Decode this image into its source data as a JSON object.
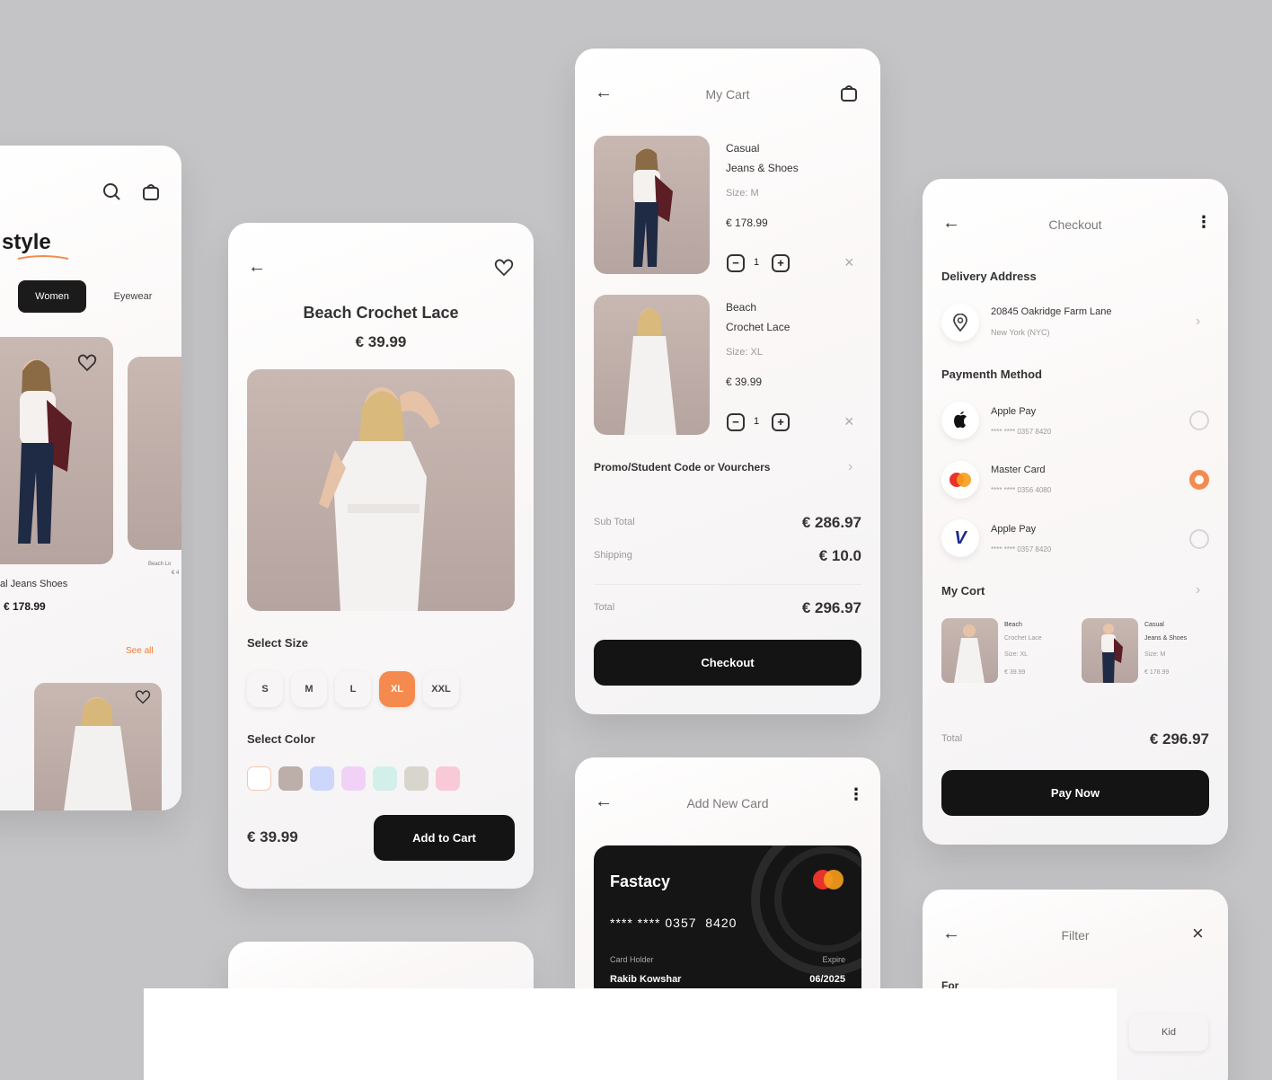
{
  "home": {
    "brand": "style",
    "tabs": [
      "Women",
      "Eyewear"
    ],
    "product_name": "al Jeans Shoes",
    "product_price": "€ 178.99",
    "side_label_1": "Beach Lo",
    "side_label_2": "€ 4",
    "see_all": "See all"
  },
  "product": {
    "title": "Beach Crochet Lace",
    "price": "€ 39.99",
    "select_size_label": "Select Size",
    "sizes": [
      "S",
      "M",
      "L",
      "XL",
      "XXL"
    ],
    "active_size": "XL",
    "select_color_label": "Select Color",
    "colors": [
      "#ffffff",
      "#bcaea8",
      "#cdd6fb",
      "#f2d1f7",
      "#d2efe9",
      "#d8d6cc",
      "#f8c9d6"
    ],
    "bottom_price": "€ 39.99",
    "add_to_cart": "Add to Cart"
  },
  "cart": {
    "title": "My Cart",
    "items": [
      {
        "name_line1": "Casual",
        "name_line2": "Jeans & Shoes",
        "size": "Size: M",
        "price": "€ 178.99",
        "qty": "1"
      },
      {
        "name_line1": "Beach",
        "name_line2": "Crochet Lace",
        "size": "Size: XL",
        "price": "€ 39.99",
        "qty": "1"
      }
    ],
    "promo": "Promo/Student Code or Vourchers",
    "subtotal_label": "Sub Total",
    "subtotal": "€ 286.97",
    "shipping_label": "Shipping",
    "shipping": "€ 10.0",
    "total_label": "Total",
    "total": "€ 296.97",
    "checkout": "Checkout"
  },
  "checkout": {
    "title": "Checkout",
    "delivery_label": "Delivery Address",
    "address_line1": "20845 Oakridge Farm Lane",
    "address_line2": "New York (NYC)",
    "payment_label": "Paymenth Method",
    "methods": [
      {
        "name": "Apple Pay",
        "number": "**** **** 0357 8420",
        "icon": "apple-icon",
        "selected": false
      },
      {
        "name": "Master Card",
        "number": "**** **** 0356 4080",
        "icon": "mastercard-icon",
        "selected": true
      },
      {
        "name": "Apple Pay",
        "number": "**** **** 0357 8420",
        "icon": "visa-icon",
        "selected": false
      }
    ],
    "mycart_label": "My Cort",
    "mini_items": [
      {
        "l1": "Beach",
        "l2": "Crochet Lace",
        "l3": "Size: XL",
        "l4": "€ 39.99"
      },
      {
        "l1": "Casual",
        "l2": "Jeans & Shoes",
        "l3": "Size: M",
        "l4": "€ 178.99"
      }
    ],
    "total_label": "Total",
    "total": "€ 296.97",
    "pay_now": "Pay Now"
  },
  "add_card": {
    "title": "Add New Card",
    "brand": "Fastacy",
    "number": "**** **** 0357  8420",
    "holder_label": "Card Holder",
    "holder": "Rakib Kowshar",
    "expire_label": "Expire",
    "expire": "06/2025"
  },
  "filter": {
    "title": "Filter",
    "for_label": "For",
    "kid": "Kid"
  }
}
